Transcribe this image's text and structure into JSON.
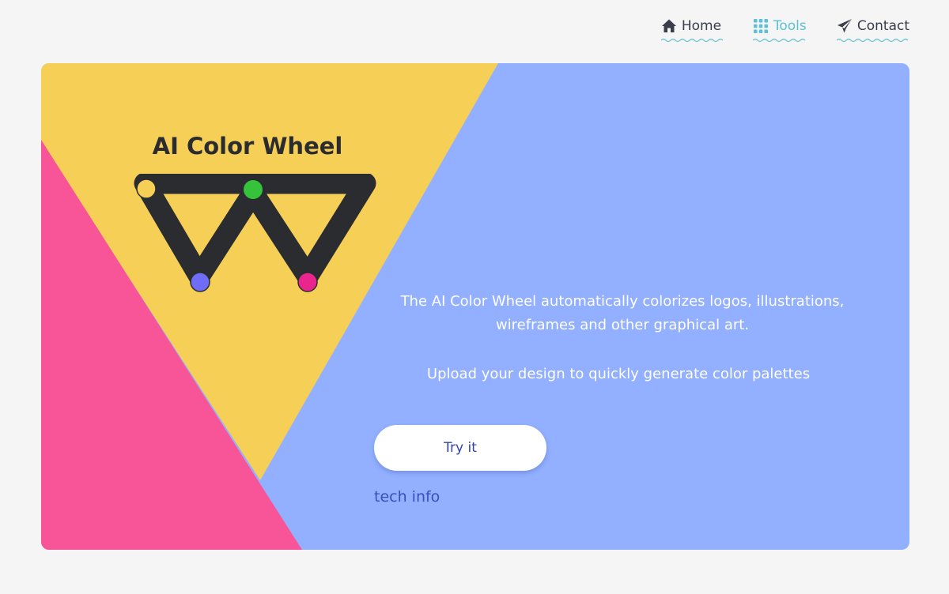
{
  "nav": {
    "items": [
      {
        "label": "Home",
        "icon": "home-icon",
        "active": false
      },
      {
        "label": "Tools",
        "icon": "grid-icon",
        "active": true
      },
      {
        "label": "Contact",
        "icon": "paper-plane-icon",
        "active": false
      }
    ]
  },
  "hero": {
    "title": "AI Color Wheel",
    "description": "The AI Color Wheel automatically colorizes logos, illustrations, wireframes and other graphical art.",
    "cta_text": "Upload your design to quickly generate color palettes",
    "try_button": "Try it",
    "tech_link": "tech info"
  },
  "colors": {
    "page_bg": "#f5f5f5",
    "hero_blue": "#93afff",
    "hero_yellow": "#f6cf57",
    "hero_pink": "#f85598",
    "logo_dark": "#2b2c2f",
    "dot_yellow": "#f6cf57",
    "dot_green": "#34c33b",
    "dot_purple": "#6f6cf8",
    "dot_magenta": "#ea258e",
    "nav_active": "#5cc0d6",
    "nav_text": "#3a3d4a",
    "link": "#3a4fb8"
  }
}
